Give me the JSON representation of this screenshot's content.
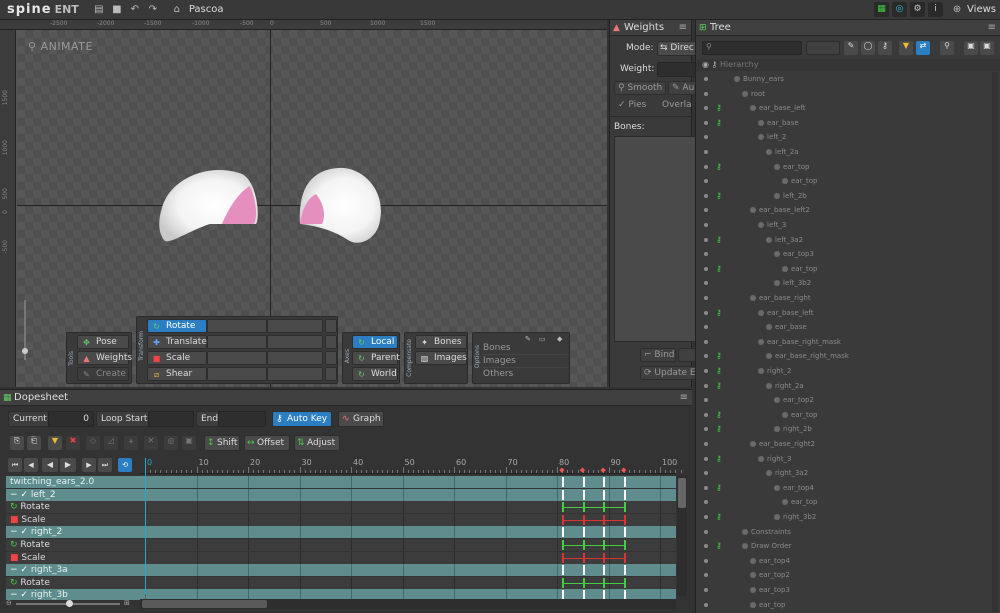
{
  "topbar": {
    "logo": "spine",
    "edition": "ENT",
    "project": "Pascoa",
    "views_label": "Views"
  },
  "viewport": {
    "mode_label": "ANIMATE",
    "ruler_top": [
      "-2500",
      "-2000",
      "-1500",
      "-1000",
      "-500",
      "0",
      "500",
      "1000",
      "1500"
    ],
    "ruler_left": [
      "1500",
      "1000",
      "500",
      "0",
      "-500"
    ],
    "tools": {
      "group_label": "Tools",
      "pose": "Pose",
      "weights": "Weights",
      "create": "Create"
    },
    "transform": {
      "group_label": "Transform",
      "rotate": "Rotate",
      "translate": "Translate",
      "scale": "Scale",
      "shear": "Shear"
    },
    "axes": {
      "group_label": "Axes",
      "local": "Local",
      "parent": "Parent",
      "world": "World"
    },
    "compensate": {
      "group_label": "Compensate",
      "bones": "Bones",
      "images": "Images"
    },
    "options": {
      "group_label": "Options",
      "bones": "Bones",
      "images": "Images",
      "others": "Others"
    }
  },
  "weights": {
    "title": "Weights",
    "mode_label": "Mode:",
    "mode_value": "Direc",
    "weight_label": "Weight:",
    "smooth": "Smooth",
    "auto": "Au",
    "pies": "Pies",
    "overlay": "Overla",
    "bones_label": "Bones:",
    "bind": "Bind",
    "update": "Update E"
  },
  "tree": {
    "title": "Tree",
    "hierarchy_label": "Hierarchy",
    "items": [
      {
        "label": "Bunny_ears",
        "indent": 0
      },
      {
        "label": "root",
        "indent": 1
      },
      {
        "label": "ear_base_left",
        "indent": 2
      },
      {
        "label": "ear_base",
        "indent": 3
      },
      {
        "label": "left_2",
        "indent": 3
      },
      {
        "label": "left_2a",
        "indent": 4
      },
      {
        "label": "ear_top",
        "indent": 5
      },
      {
        "label": "ear_top",
        "indent": 6
      },
      {
        "label": "left_2b",
        "indent": 5
      },
      {
        "label": "ear_base_left2",
        "indent": 2
      },
      {
        "label": "left_3",
        "indent": 3
      },
      {
        "label": "left_3a2",
        "indent": 4
      },
      {
        "label": "ear_top3",
        "indent": 5
      },
      {
        "label": "ear_top",
        "indent": 6
      },
      {
        "label": "left_3b2",
        "indent": 5
      },
      {
        "label": "ear_base_right",
        "indent": 2
      },
      {
        "label": "ear_base_left",
        "indent": 3
      },
      {
        "label": "ear_base",
        "indent": 4
      },
      {
        "label": "ear_base_right_mask",
        "indent": 3
      },
      {
        "label": "ear_base_right_mask",
        "indent": 4
      },
      {
        "label": "right_2",
        "indent": 3
      },
      {
        "label": "right_2a",
        "indent": 4
      },
      {
        "label": "ear_top2",
        "indent": 5
      },
      {
        "label": "ear_top",
        "indent": 6
      },
      {
        "label": "right_2b",
        "indent": 5
      },
      {
        "label": "ear_base_right2",
        "indent": 2
      },
      {
        "label": "right_3",
        "indent": 3
      },
      {
        "label": "right_3a2",
        "indent": 4
      },
      {
        "label": "ear_top4",
        "indent": 5
      },
      {
        "label": "ear_top",
        "indent": 6
      },
      {
        "label": "right_3b2",
        "indent": 5
      },
      {
        "label": "Constraints",
        "indent": 1
      },
      {
        "label": "Draw Order",
        "indent": 1
      },
      {
        "label": "ear_top4",
        "indent": 2
      },
      {
        "label": "ear_top2",
        "indent": 2
      },
      {
        "label": "ear_top3",
        "indent": 2
      },
      {
        "label": "ear_top",
        "indent": 2
      }
    ]
  },
  "dopesheet": {
    "title": "Dopesheet",
    "current_label": "Current",
    "current_value": "0",
    "loop_start_label": "Loop Start",
    "end_label": "End",
    "auto_key": "Auto Key",
    "graph": "Graph",
    "shift": "Shift",
    "offset": "Offset",
    "adjust": "Adjust",
    "ticks": [
      "0",
      "10",
      "20",
      "30",
      "40",
      "50",
      "60",
      "70",
      "80",
      "90",
      "100"
    ],
    "tracks": [
      {
        "label": "twitching_ears_2.0",
        "type": "anim"
      },
      {
        "label": "left_2",
        "type": "bone"
      },
      {
        "label": "Rotate",
        "type": "rotate"
      },
      {
        "label": "Scale",
        "type": "scale"
      },
      {
        "label": "right_2",
        "type": "bone"
      },
      {
        "label": "Rotate",
        "type": "rotate"
      },
      {
        "label": "Scale",
        "type": "scale"
      },
      {
        "label": "right_3a",
        "type": "bone"
      },
      {
        "label": "Rotate",
        "type": "rotate"
      },
      {
        "label": "right_3b",
        "type": "bone"
      }
    ]
  },
  "colors": {
    "accent": "#2a7ec1",
    "key_red": "#d33",
    "key_green": "#4c4",
    "track_header": "#5f8c8c"
  }
}
